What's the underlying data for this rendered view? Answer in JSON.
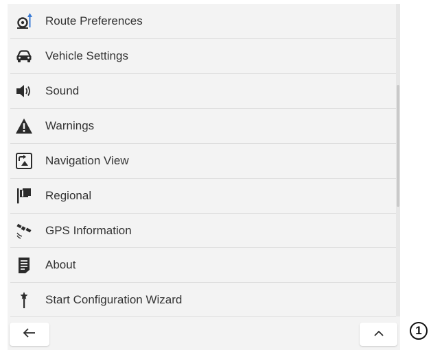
{
  "menu": {
    "items": [
      {
        "label": "Route Preferences",
        "icon": "route-preferences-icon"
      },
      {
        "label": "Vehicle Settings",
        "icon": "car-icon"
      },
      {
        "label": "Sound",
        "icon": "speaker-icon"
      },
      {
        "label": "Warnings",
        "icon": "warning-triangle-icon"
      },
      {
        "label": "Navigation View",
        "icon": "navigation-view-icon"
      },
      {
        "label": "Regional",
        "icon": "flag-icon"
      },
      {
        "label": "GPS Information",
        "icon": "satellite-icon"
      },
      {
        "label": "About",
        "icon": "document-icon"
      },
      {
        "label": "Start Configuration Wizard",
        "icon": "wand-icon"
      }
    ]
  },
  "bottombar": {
    "back_icon": "back-arrow-icon",
    "up_icon": "chevron-up-icon"
  },
  "callout": {
    "label": "1"
  },
  "colors": {
    "background": "#f3f3f3",
    "text": "#333333",
    "icon": "#2b2b2b",
    "accent": "#3a7bd5"
  }
}
